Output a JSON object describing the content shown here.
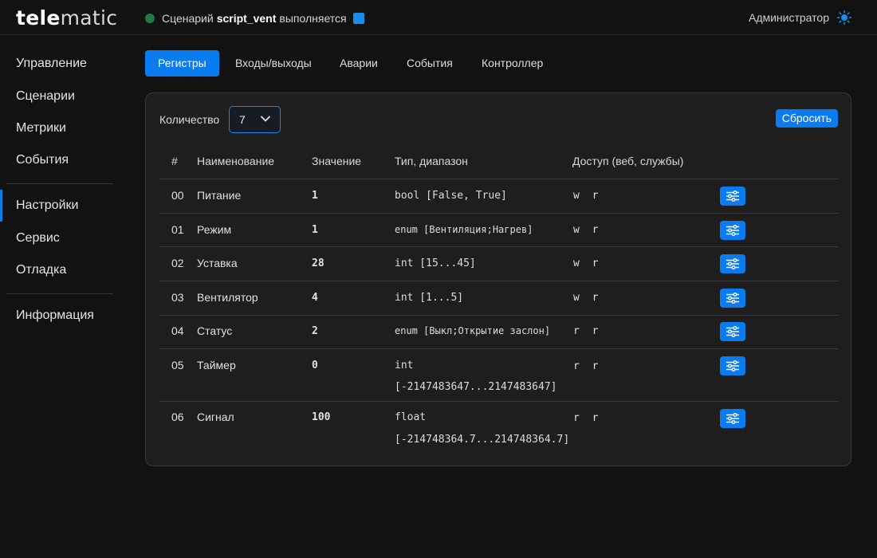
{
  "logo": {
    "bold": "tele",
    "light": "matic"
  },
  "status": {
    "prefix": "Сценарий",
    "script": "script_vent",
    "suffix": "выполняется",
    "dot_color": "#1f7a45",
    "square_color": "#1a8cf0"
  },
  "user": {
    "name": "Администратор",
    "theme_icon": "sun-icon"
  },
  "sidebar": {
    "items": [
      {
        "label": "Управление"
      },
      {
        "label": "Сценарии"
      },
      {
        "label": "Метрики"
      },
      {
        "label": "События"
      },
      {
        "label": "Настройки",
        "active": true
      },
      {
        "label": "Сервис"
      },
      {
        "label": "Отладка"
      },
      {
        "label": "Информация"
      }
    ]
  },
  "tabs": [
    {
      "label": "Регистры",
      "active": true
    },
    {
      "label": "Входы/выходы"
    },
    {
      "label": "Аварии"
    },
    {
      "label": "События"
    },
    {
      "label": "Контроллер"
    }
  ],
  "controls": {
    "count_label": "Количество",
    "count_value": "7",
    "reset_label": "Сбросить"
  },
  "table": {
    "headers": {
      "num": "#",
      "name": "Наименование",
      "value": "Значение",
      "type": "Тип, диапазон",
      "access": "Доступ (веб, службы)"
    },
    "rows": [
      {
        "num": "00",
        "name": "Питание",
        "value": "1",
        "type": "bool [False, True]",
        "access": "w r"
      },
      {
        "num": "01",
        "name": "Режим",
        "value": "1",
        "type": "enum [Вентиляция;Нагрев]",
        "access": "w r"
      },
      {
        "num": "02",
        "name": "Уставка",
        "value": "28",
        "type": "int [15...45]",
        "access": "w r"
      },
      {
        "num": "03",
        "name": "Вентилятор",
        "value": "4",
        "type": "int [1...5]",
        "access": "w r"
      },
      {
        "num": "04",
        "name": "Статус",
        "value": "2",
        "type": "enum [Выкл;Открытие заслон]",
        "access": "r r"
      },
      {
        "num": "05",
        "name": "Таймер",
        "value": "0",
        "type": "int",
        "type2": "[-2147483647...2147483647]",
        "access": "r r"
      },
      {
        "num": "06",
        "name": "Сигнал",
        "value": "100",
        "type": "float",
        "type2": "[-214748364.7...214748364.7]",
        "access": "r r"
      }
    ],
    "row_action_icon": "sliders-icon"
  },
  "colors": {
    "accent": "#0a7cf0",
    "background": "#121212",
    "card": "#1e1e1e"
  }
}
